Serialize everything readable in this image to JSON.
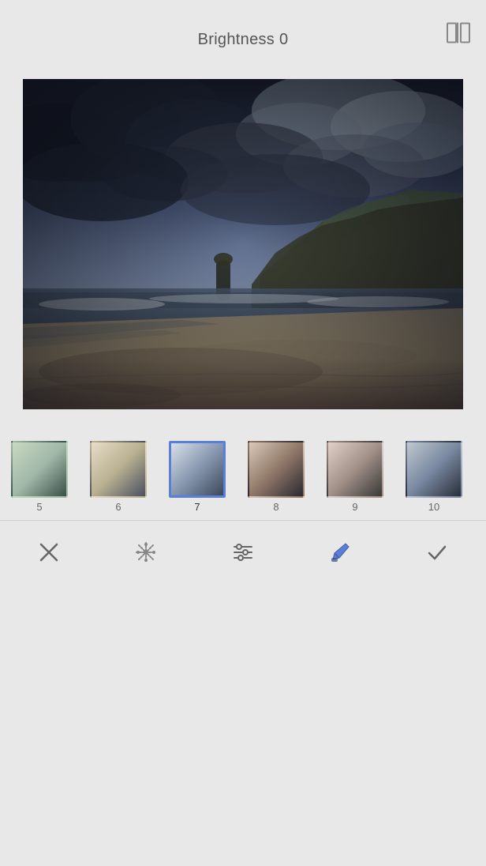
{
  "header": {
    "title": "Brightness",
    "value": "0",
    "compare_icon_label": "compare-icon"
  },
  "filters": {
    "items": [
      {
        "id": 5,
        "label": "5",
        "thumb_class": "thumb-5",
        "active": false
      },
      {
        "id": 6,
        "label": "6",
        "thumb_class": "thumb-6",
        "active": false
      },
      {
        "id": 7,
        "label": "7",
        "thumb_class": "thumb-7",
        "active": true
      },
      {
        "id": 8,
        "label": "8",
        "thumb_class": "thumb-8",
        "active": false
      },
      {
        "id": 9,
        "label": "9",
        "thumb_class": "thumb-9",
        "active": false
      },
      {
        "id": 10,
        "label": "10",
        "thumb_class": "thumb-10",
        "active": false
      }
    ]
  },
  "toolbar": {
    "cancel_label": "✕",
    "effects_label": "effects",
    "adjust_label": "adjust",
    "style_label": "style",
    "confirm_label": "✓"
  }
}
